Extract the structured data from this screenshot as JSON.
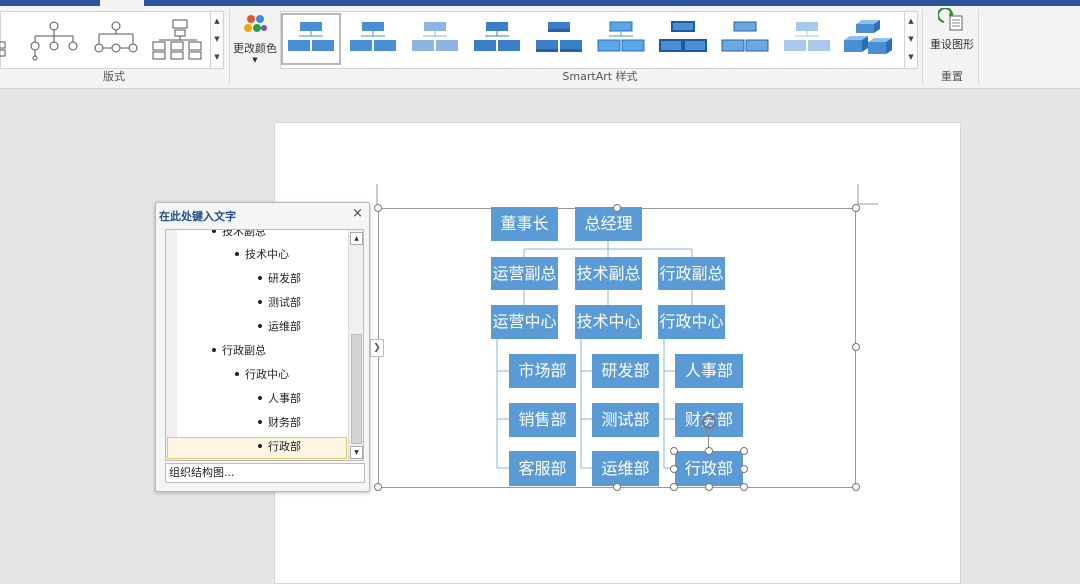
{
  "ribbon": {
    "layout_group_label": "版式",
    "change_colors_label": "更改颜色",
    "styles_group_label": "SmartArt 样式",
    "reset_group_label": "重置",
    "reset_graphic_label": "重设图形"
  },
  "text_pane": {
    "title": "在此处键入文字",
    "close_glyph": "×",
    "items": [
      {
        "text": "技术副总"
      },
      {
        "text": "技术中心"
      },
      {
        "text": "研发部"
      },
      {
        "text": "测试部"
      },
      {
        "text": "运维部"
      },
      {
        "text": "行政副总"
      },
      {
        "text": "行政中心"
      },
      {
        "text": "人事部"
      },
      {
        "text": "财务部"
      },
      {
        "text": "行政部"
      }
    ],
    "footer": "组织结构图..."
  },
  "org_chart": {
    "chairman": "董事长",
    "gm": "总经理",
    "vp_ops": "运营副总",
    "vp_tech": "技术副总",
    "vp_admin": "行政副总",
    "center_ops": "运营中心",
    "center_tech": "技术中心",
    "center_admin": "行政中心",
    "dept_market": "市场部",
    "dept_sales": "销售部",
    "dept_service": "客服部",
    "dept_rd": "研发部",
    "dept_test": "测试部",
    "dept_ops": "运维部",
    "dept_hr": "人事部",
    "dept_finance": "财务部",
    "dept_admin": "行政部"
  },
  "colors": {
    "accent": "#5b9bd5",
    "title_bar": "#2b579a"
  }
}
